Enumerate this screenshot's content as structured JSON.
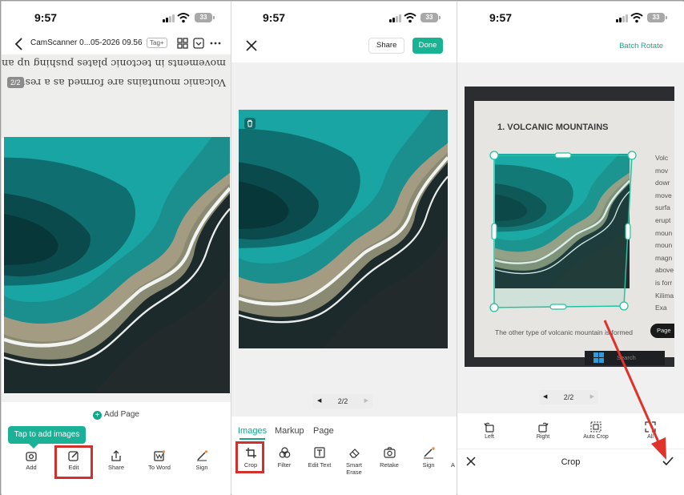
{
  "status_time": "9:57",
  "battery": "33",
  "panel1": {
    "doc_title": "CamScanner 0...05-2026 09.56",
    "tag_label": "Tag+",
    "scan_lines": [
      "Volcanic mountains are formed as a result",
      "movements in tectonic plates pushing up and"
    ],
    "page_badge": "2/2",
    "add_page": "Add Page",
    "tooltip": "Tap to add images",
    "bottom_items": [
      {
        "label": "Add",
        "icon": "add-image-icon"
      },
      {
        "label": "Edit",
        "icon": "edit-icon"
      },
      {
        "label": "Share",
        "icon": "share-icon"
      },
      {
        "label": "To Word",
        "icon": "word-icon"
      },
      {
        "label": "Sign",
        "icon": "sign-icon"
      }
    ]
  },
  "panel2": {
    "share": "Share",
    "done": "Done",
    "pager": "2/2",
    "tabs": [
      "Images",
      "Markup",
      "Page"
    ],
    "active_tab": "Images",
    "tools": [
      {
        "label": "Crop",
        "icon": "crop-icon"
      },
      {
        "label": "Filter",
        "icon": "filter-icon"
      },
      {
        "label": "Edit Text",
        "icon": "edit-text-icon"
      },
      {
        "label": "Smart Erase",
        "icon": "eraser-icon"
      },
      {
        "label": "Retake",
        "icon": "camera-icon"
      },
      {
        "label": "Sign",
        "icon": "sign-icon"
      }
    ],
    "overflow_char": "A"
  },
  "panel3": {
    "batch_rotate": "Batch Rotate",
    "heading": "1. VOLCANIC MOUNTAINS",
    "side_words": [
      "Volc",
      "mov",
      "dowr",
      "move",
      "surfa",
      "erupt",
      "moun",
      "moun",
      "magn",
      "above",
      "is forr",
      "Kilima",
      "Exa"
    ],
    "bottom_text": "The other type of volcanic mountain is formed",
    "search": "Search",
    "page_pill": "Page",
    "pager": "2/2",
    "tools": [
      {
        "label": "Left",
        "icon": "rotate-left-icon"
      },
      {
        "label": "Right",
        "icon": "rotate-right-icon"
      },
      {
        "label": "Auto Crop",
        "icon": "auto-crop-icon"
      },
      {
        "label": "All",
        "icon": "expand-icon"
      }
    ],
    "crop_title": "Crop"
  },
  "colors": {
    "accent": "#18b393",
    "highlight": "#d0312d",
    "arrow": "#e0312b"
  }
}
